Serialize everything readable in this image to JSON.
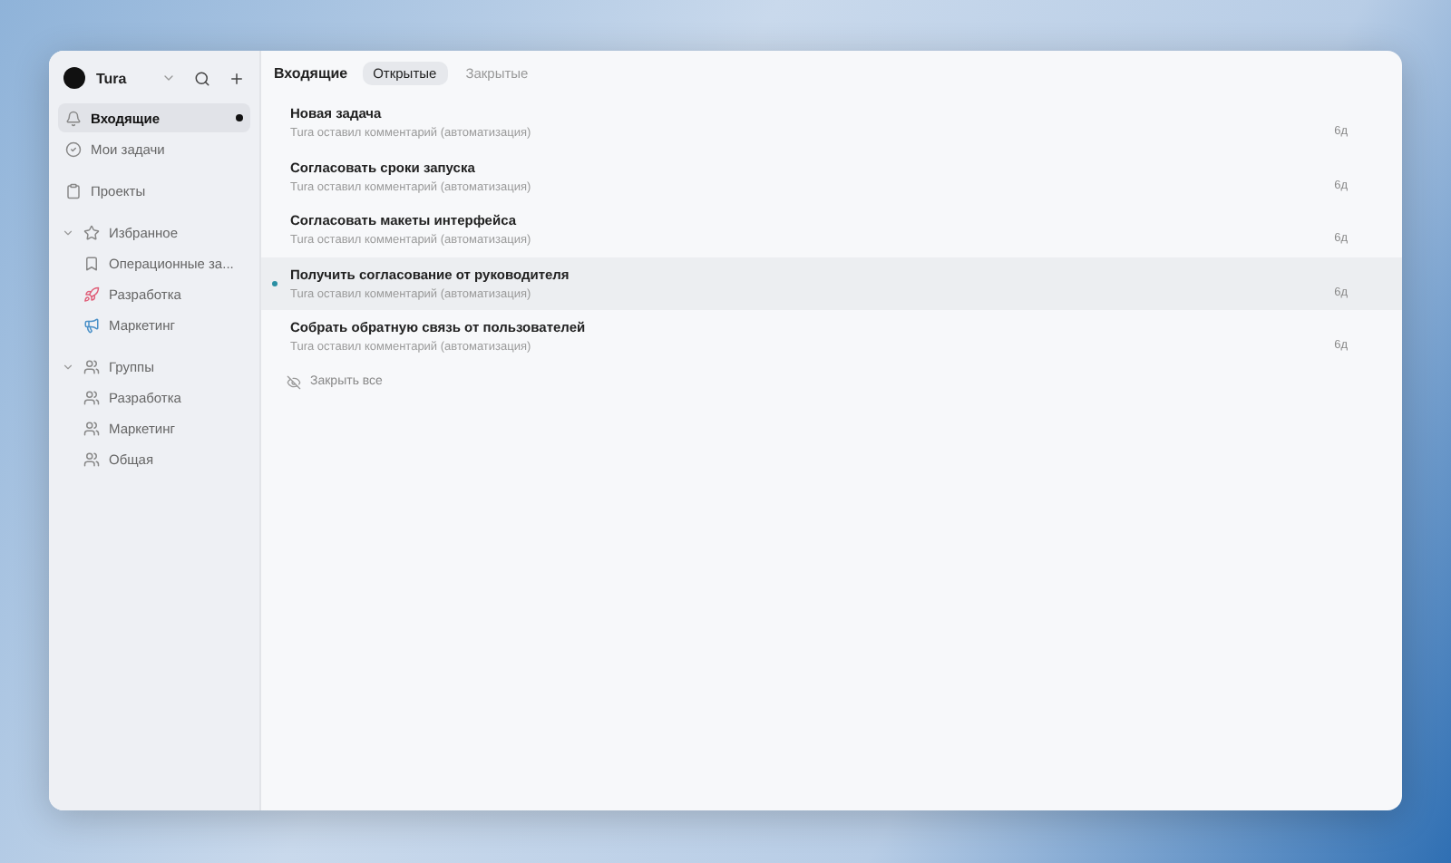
{
  "workspace": {
    "name": "Tura"
  },
  "sidebar": {
    "items": [
      {
        "label": "Входящие",
        "selected": true,
        "unread": true,
        "kind": "bell"
      },
      {
        "label": "Мои задачи",
        "selected": false,
        "unread": false,
        "kind": "check"
      },
      {
        "label": "Проекты",
        "selected": false,
        "unread": false,
        "kind": "clipboard"
      }
    ],
    "sections": [
      {
        "label": "Избранное",
        "expanded": true,
        "kind": "star",
        "children": [
          {
            "label": "Операционные за...",
            "kind": "bookmark"
          },
          {
            "label": "Разработка",
            "kind": "rocket"
          },
          {
            "label": "Маркетинг",
            "kind": "megaphone"
          }
        ]
      },
      {
        "label": "Группы",
        "expanded": true,
        "kind": "users",
        "children": [
          {
            "label": "Разработка",
            "kind": "users"
          },
          {
            "label": "Маркетинг",
            "kind": "users"
          },
          {
            "label": "Общая",
            "kind": "users"
          }
        ]
      }
    ]
  },
  "title": "Входящие",
  "tabs": [
    {
      "label": "Открытые",
      "selected": true
    },
    {
      "label": "Закрытые",
      "selected": false
    }
  ],
  "notifications": [
    {
      "title": "Новая задача",
      "subtitle": "Tura оставил комментарий (автоматизация)",
      "age": "6д",
      "selected": false
    },
    {
      "title": "Согласовать сроки запуска",
      "subtitle": "Tura оставил комментарий (автоматизация)",
      "age": "6д",
      "selected": false
    },
    {
      "title": "Согласовать макеты интерфейса",
      "subtitle": "Tura оставил комментарий (автоматизация)",
      "age": "6д",
      "selected": false
    },
    {
      "title": "Получить согласование от руководителя",
      "subtitle": "Tura оставил комментарий (автоматизация)",
      "age": "6д",
      "selected": true
    },
    {
      "title": "Собрать обратную связь от пользователей",
      "subtitle": "Tura оставил комментарий (автоматизация)",
      "age": "6д",
      "selected": false
    }
  ],
  "close_all": "Закрыть все"
}
